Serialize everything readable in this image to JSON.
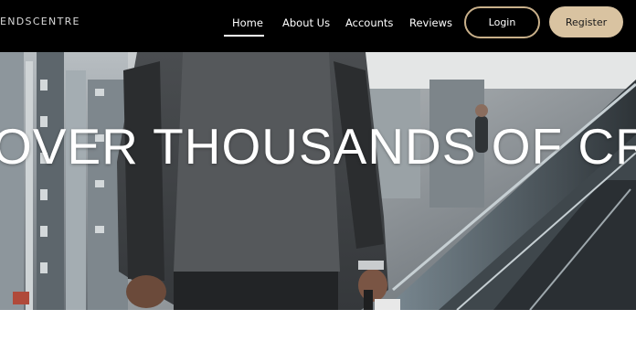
{
  "header": {
    "brand": "ENDSCENTRE",
    "nav": {
      "home": "Home",
      "about": "About Us",
      "accounts": "Accounts",
      "reviews": "Reviews"
    },
    "login_label": "Login",
    "register_label": "Register"
  },
  "hero": {
    "headline": "OVER THOUSANDS OF CR"
  },
  "colors": {
    "nav_background": "#000000",
    "login_border": "#c9b08a",
    "register_background": "#d9c3a1"
  }
}
